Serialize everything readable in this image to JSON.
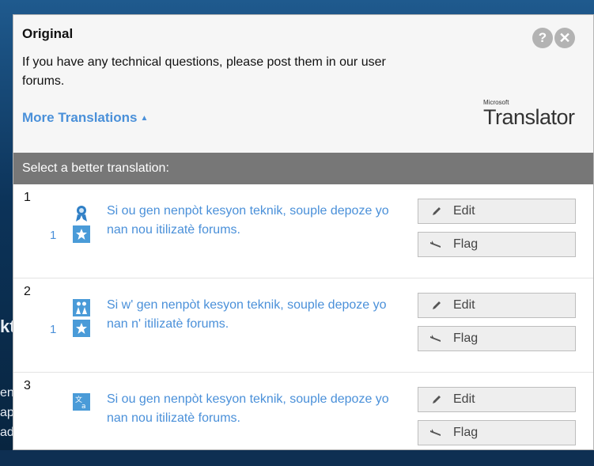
{
  "background": {
    "heading": "kt",
    "lines": [
      "en",
      "ap",
      "ad"
    ]
  },
  "panel": {
    "title": "Original",
    "original_text": "If you have any technical questions, please post them in our user forums.",
    "more_translations": "More Translations",
    "help_label": "?",
    "close_label": "✕",
    "brand_small": "Microsoft",
    "brand_big": "Translator",
    "select_prompt": "Select a better translation:"
  },
  "translations": [
    {
      "rank": "1",
      "text": "Si ou gen nenpòt kesyon teknik, souple depoze yo nan nou itilizatè forums.",
      "votes": "1",
      "edit_label": "Edit",
      "flag_label": "Flag",
      "source_icon": "ribbon-icon"
    },
    {
      "rank": "2",
      "text": "Si w' gen nenpòt kesyon teknik, souple depoze yo nan n' itilizatè forums.",
      "votes": "1",
      "edit_label": "Edit",
      "flag_label": "Flag",
      "source_icon": "community-icon"
    },
    {
      "rank": "3",
      "text": "Si ou gen nenpòt kesyon teknik, souple depoze yo nan nou itilizatè forums.",
      "votes": "",
      "edit_label": "Edit",
      "flag_label": "Flag",
      "source_icon": "machine-translation-icon"
    }
  ],
  "colors": {
    "accent": "#4a90d9",
    "header_bar": "#777777",
    "button_bg": "#eeeeee"
  }
}
